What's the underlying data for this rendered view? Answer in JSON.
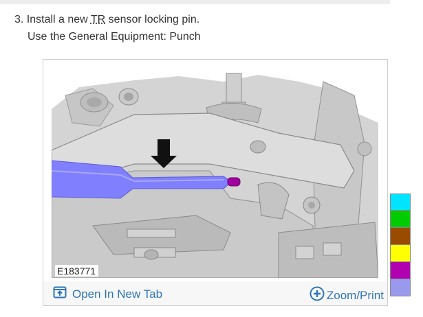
{
  "step": {
    "number": "3.",
    "line1_prefix": "Install a new ",
    "abbr": "TR",
    "line1_suffix": " sensor locking pin.",
    "line2": "Use the General Equipment: Punch"
  },
  "figure": {
    "id": "E183771",
    "open_tab_label": "Open In New Tab",
    "zoom_label": "Zoom/Print",
    "open_tab_icon": "open-new-tab-icon",
    "zoom_icon": "plus-circle-icon"
  },
  "colors": {
    "link": "#2e75b6",
    "punch_tool": "#8080ff",
    "pin": "#a000a0",
    "swatches": [
      "#00e5ff",
      "#00cc00",
      "#994c00",
      "#ffff00",
      "#b000b0",
      "#9999ee"
    ]
  }
}
